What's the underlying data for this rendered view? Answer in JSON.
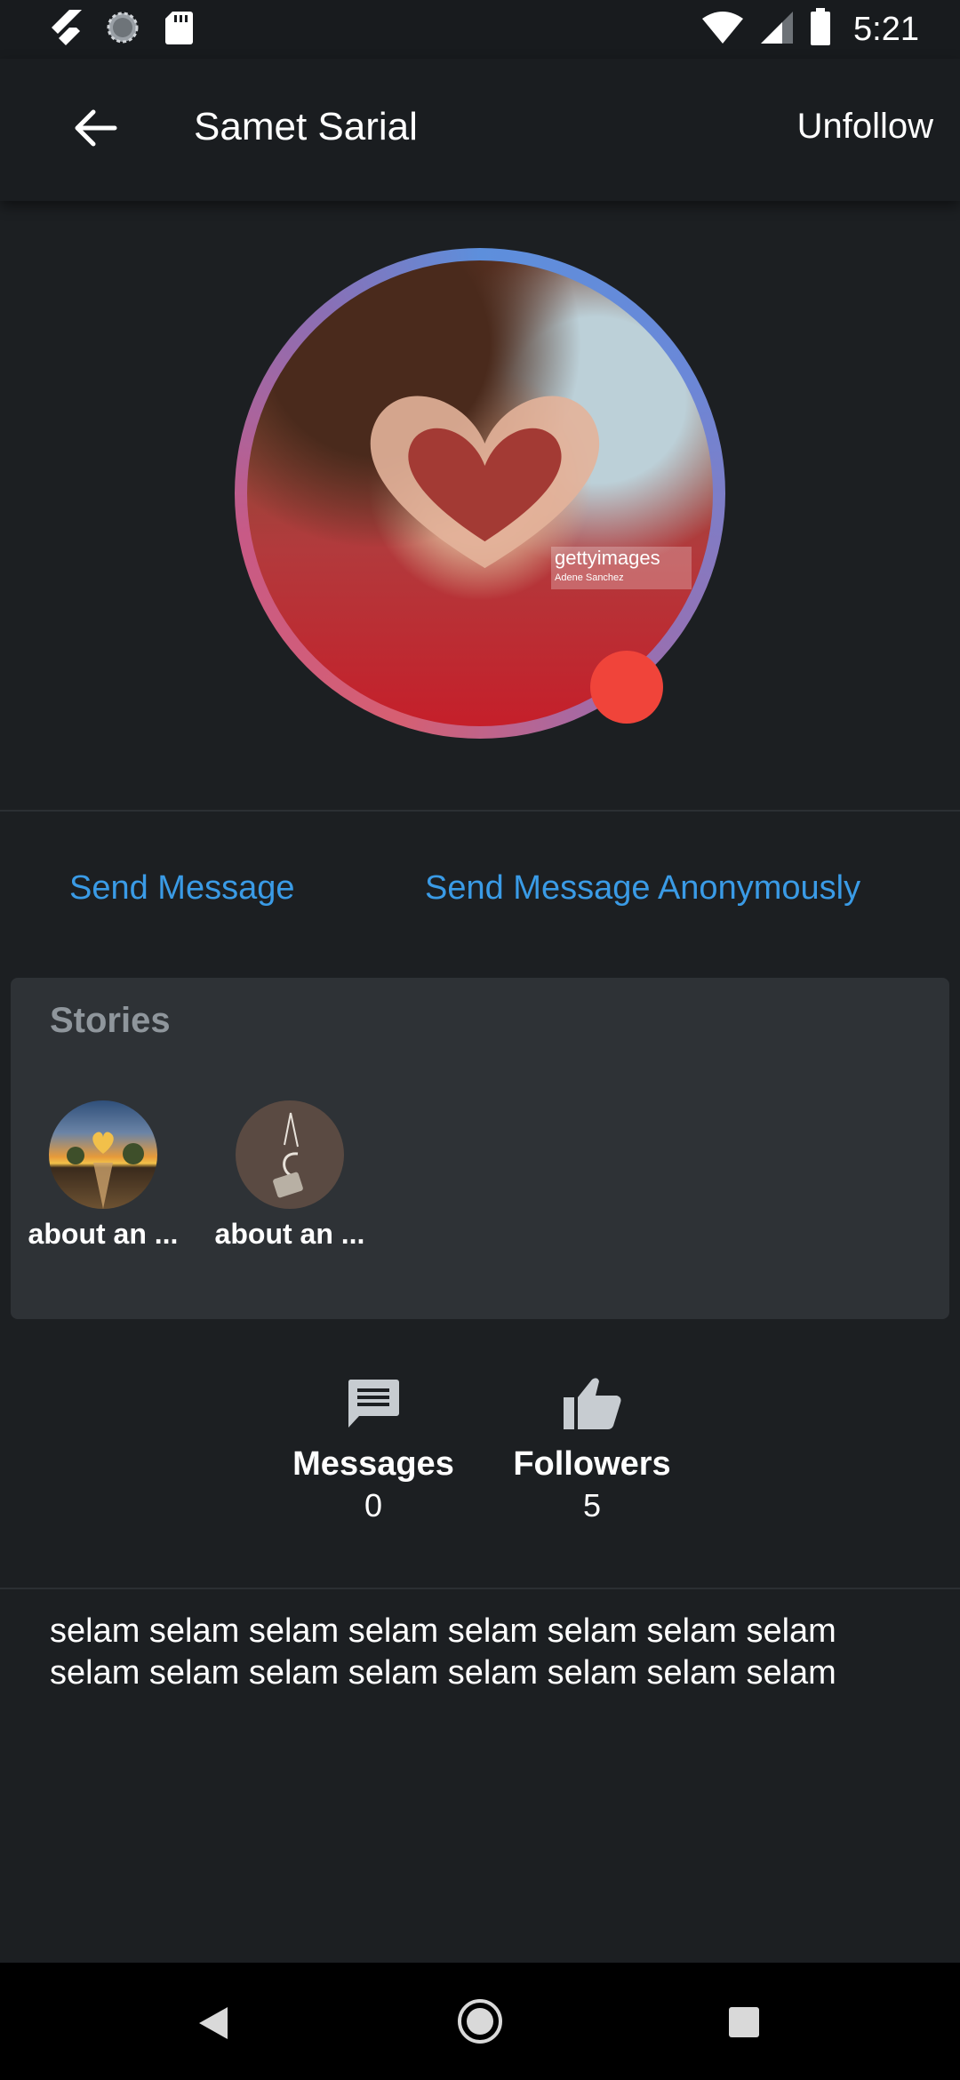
{
  "status_bar": {
    "time": "5:21",
    "icons": [
      "flutter-icon",
      "sync-icon",
      "sd-card-icon",
      "wifi-icon",
      "signal-icon",
      "battery-icon"
    ]
  },
  "app_bar": {
    "title": "Samet Sarial",
    "action": "Unfollow",
    "icons": [
      "back-arrow-icon"
    ]
  },
  "profile": {
    "avatar_watermark": "gettyimages",
    "avatar_watermark_sub": "Adene Sanchez",
    "online": true,
    "online_color": "#f0443a"
  },
  "actions": {
    "send_message": "Send Message",
    "send_anonymous": "Send Message Anonymously",
    "link_color": "#3a9be6"
  },
  "stories": {
    "title": "Stories",
    "items": [
      {
        "label": "about an ..."
      },
      {
        "label": "about an ..."
      }
    ]
  },
  "stats": {
    "messages": {
      "label": "Messages",
      "value": "0",
      "icon": "message-icon"
    },
    "followers": {
      "label": "Followers",
      "value": "5",
      "icon": "thumb-up-icon"
    }
  },
  "bio": {
    "text": "selam selam selam selam selam selam selam selam selam selam selam selam selam selam selam selam"
  },
  "nav_bar": {
    "icons": [
      "nav-back-icon",
      "nav-home-icon",
      "nav-recents-icon"
    ]
  },
  "colors": {
    "background": "#1c1f22",
    "card": "#2e3236",
    "accent": "#3a9be6"
  }
}
